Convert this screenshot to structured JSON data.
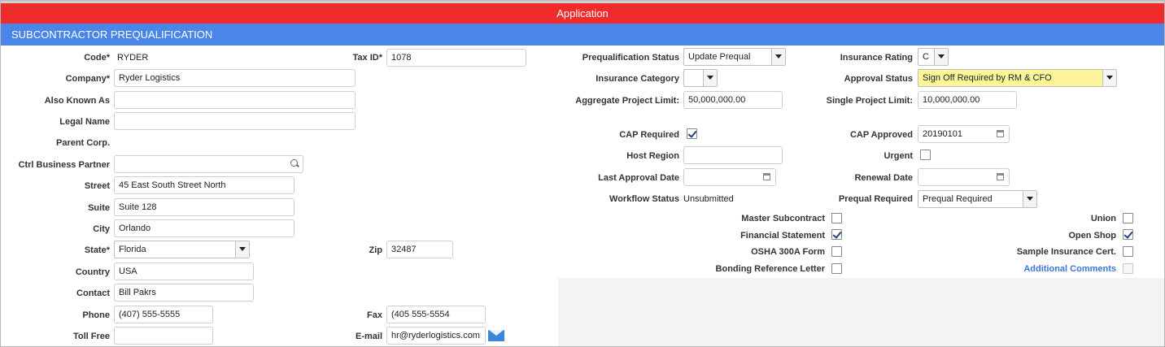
{
  "header": {
    "app_title": "Application",
    "section_title": "SUBCONTRACTOR PREQUALIFICATION"
  },
  "left": {
    "code": {
      "label": "Code*",
      "value": "RYDER"
    },
    "tax_id": {
      "label": "Tax ID*",
      "value": "1078"
    },
    "company": {
      "label": "Company*",
      "value": "Ryder Logistics"
    },
    "aka": {
      "label": "Also Known As",
      "value": ""
    },
    "legal_name": {
      "label": "Legal Name",
      "value": ""
    },
    "parent_corp": {
      "label": "Parent Corp."
    },
    "ctrl_business_partner": {
      "label": "Ctrl Business Partner",
      "value": ""
    },
    "street": {
      "label": "Street",
      "value": "45 East South Street North"
    },
    "suite": {
      "label": "Suite",
      "value": "Suite 128"
    },
    "city": {
      "label": "City",
      "value": "Orlando"
    },
    "state": {
      "label": "State*",
      "value": "Florida"
    },
    "zip": {
      "label": "Zip",
      "value": "32487"
    },
    "country": {
      "label": "Country",
      "value": "USA"
    },
    "contact": {
      "label": "Contact",
      "value": "Bill Pakrs"
    },
    "phone": {
      "label": "Phone",
      "value": "(407) 555-5555"
    },
    "fax": {
      "label": "Fax",
      "value": "(405 555-5554"
    },
    "toll_free": {
      "label": "Toll Free",
      "value": ""
    },
    "email": {
      "label": "E-mail",
      "value": "hr@ryderlogistics.com"
    }
  },
  "right": {
    "prequal_status": {
      "label": "Prequalification Status",
      "value": "Update Prequal"
    },
    "insurance_rating": {
      "label": "Insurance Rating",
      "value": "C"
    },
    "insurance_category": {
      "label": "Insurance Category",
      "value": ""
    },
    "approval_status": {
      "label": "Approval Status",
      "value": "Sign Off Required by RM & CFO"
    },
    "aggregate_limit": {
      "label": "Aggregate Project Limit:",
      "value": "50,000,000.00"
    },
    "single_limit": {
      "label": "Single Project Limit:",
      "value": "10,000,000.00"
    },
    "cap_required": {
      "label": "CAP Required",
      "checked": true
    },
    "cap_approved": {
      "label": "CAP Approved",
      "value": "20190101"
    },
    "host_region": {
      "label": "Host Region",
      "value": ""
    },
    "urgent": {
      "label": "Urgent",
      "checked": false
    },
    "last_approval_date": {
      "label": "Last Approval Date",
      "value": ""
    },
    "renewal_date": {
      "label": "Renewal Date",
      "value": ""
    },
    "workflow_status": {
      "label": "Workflow Status",
      "value": "Unsubmitted"
    },
    "prequal_required": {
      "label": "Prequal Required",
      "value": "Prequal Required"
    },
    "master_subcontract": {
      "label": "Master Subcontract",
      "checked": false
    },
    "union": {
      "label": "Union",
      "checked": false
    },
    "financial_statement": {
      "label": "Financial Statement",
      "checked": true
    },
    "open_shop": {
      "label": "Open Shop",
      "checked": true
    },
    "osha_form": {
      "label": "OSHA 300A Form",
      "checked": false
    },
    "sample_insurance": {
      "label": "Sample Insurance Cert.",
      "checked": false
    },
    "bonding_letter": {
      "label": "Bonding Reference Letter",
      "checked": false
    },
    "additional_comments": {
      "label": "Additional Comments",
      "checked": false
    }
  },
  "icons": {
    "email": "envelope-icon",
    "search": "search-icon",
    "calendar": "calendar-icon"
  },
  "colors": {
    "app_bar": "#f02b2b",
    "section_bar": "#4a86e8",
    "highlight_field": "#fdf59a",
    "link": "#3b78d8"
  }
}
